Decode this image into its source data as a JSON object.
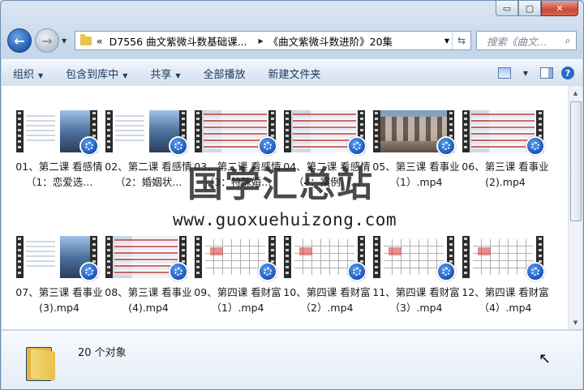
{
  "window": {
    "controls": {
      "minimize": "▭",
      "maximize": "▢",
      "close": "✕"
    }
  },
  "nav": {
    "back_icon": "arrow-left",
    "forward_icon": "arrow-right",
    "address": {
      "prefix": "«",
      "crumb1": "D7556 曲文紫微斗数基础课...",
      "crumb2": "《曲文紫微斗数进阶》20集"
    },
    "search_placeholder": "搜索《曲文...",
    "refresh_icon": "refresh"
  },
  "toolbar": {
    "organize": "组织",
    "include_library": "包含到库中",
    "share": "共享",
    "play_all": "全部播放",
    "new_folder": "新建文件夹"
  },
  "files": [
    {
      "name": "01、第二课 看感情（1：恋爱选..."
    },
    {
      "name": "02、第二课  看感情（2：婚姻状..."
    },
    {
      "name": "03、第二课 看感情（3：特殊婚..."
    },
    {
      "name": "04、第二课 看感情（4：案例（..."
    },
    {
      "name": "05、第三课  看事业（1）.mp4"
    },
    {
      "name": "06、第三课  看事业(2).mp4"
    },
    {
      "name": "07、第三课  看事业(3).mp4"
    },
    {
      "name": "08、第三课  看事业(4).mp4"
    },
    {
      "name": "09、第四课 看财富（1）.mp4"
    },
    {
      "name": "10、第四课 看财富（2）.mp4"
    },
    {
      "name": "11、第四课 看财富（3）.mp4"
    },
    {
      "name": "12、第四课 看财富（4）.mp4"
    }
  ],
  "watermark": {
    "cn": "国学汇总站",
    "url": "www.guoxuehuizong.com"
  },
  "status": {
    "count": "20 个对象"
  }
}
